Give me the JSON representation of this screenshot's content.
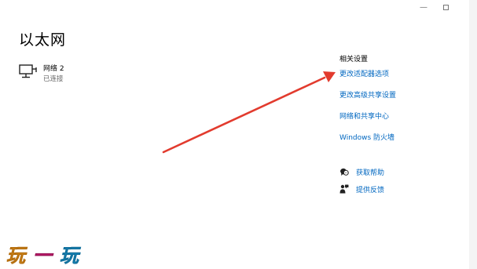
{
  "window": {
    "minimize_glyph": "—",
    "maximize_glyph": "☐"
  },
  "page": {
    "title": "以太网"
  },
  "network": {
    "name": "网络 2",
    "status": "已连接",
    "icon": "ethernet-monitor-icon"
  },
  "related_settings": {
    "heading": "相关设置",
    "links": [
      {
        "label": "更改适配器选项"
      },
      {
        "label": "更改高级共享设置"
      },
      {
        "label": "网络和共享中心"
      },
      {
        "label": "Windows 防火墙"
      }
    ]
  },
  "help": {
    "items": [
      {
        "label": "获取帮助",
        "icon": "chat-help-icon"
      },
      {
        "label": "提供反馈",
        "icon": "feedback-person-icon"
      }
    ]
  },
  "annotation": {
    "arrow_color": "#e23b2e"
  },
  "watermark": {
    "text": "玩一玩",
    "colors": [
      "#f0a020",
      "#d81e7a",
      "#1aa0dc"
    ]
  },
  "colors": {
    "link": "#0067c0",
    "secondary_text": "#666666"
  }
}
